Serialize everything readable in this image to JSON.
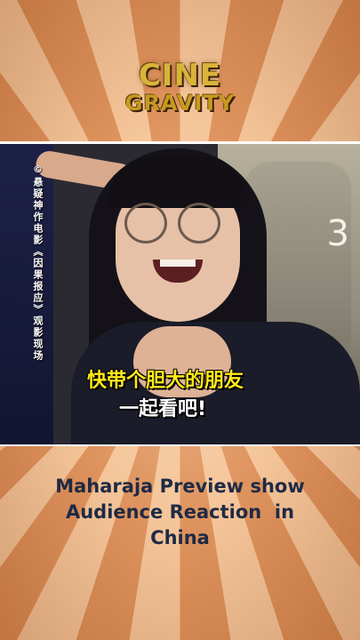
{
  "logo": {
    "line1": "CINE",
    "line2": "GRAVITY"
  },
  "video": {
    "side_text": "©悬疑神作电影《因果报应》观影现场",
    "seat_number": "3",
    "subtitle_line1": "快带个胆大的朋友",
    "subtitle_line2": "一起看吧!"
  },
  "caption": {
    "line1": "Maharaja Preview show",
    "line2": "Audience Reaction  in",
    "line3": "China"
  },
  "colors": {
    "ray_light": "#f3c195",
    "ray_dark": "#d9874f",
    "logo_gold": "#d9b43a",
    "caption_text": "#1e2a45",
    "subtitle_yellow": "#ffea1a"
  }
}
